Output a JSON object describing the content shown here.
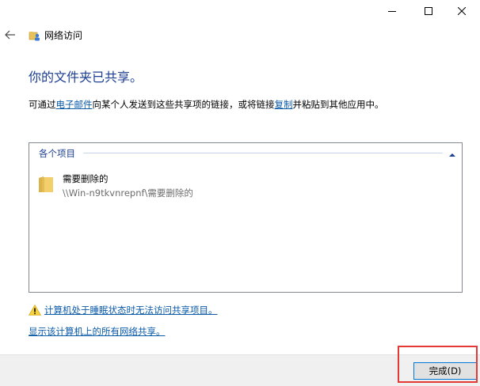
{
  "window": {
    "controls": [
      "minimize-icon",
      "maximize-icon",
      "close-icon"
    ]
  },
  "nav": {
    "back_icon": "back-arrow-icon",
    "title": "网络访问"
  },
  "main": {
    "heading": "你的文件夹已共享。",
    "desc_before_email": "可通过",
    "email_link": "电子邮件",
    "desc_middle": "向某个人发送到这些共享项的链接，或将链接",
    "copy_link": "复制",
    "desc_after": "并粘贴到其他应用中。"
  },
  "list": {
    "group_title": "各个项目",
    "items": [
      {
        "name": "需要删除的",
        "path": "\\\\Win-n9tkvnrepnf\\需要删除的"
      }
    ]
  },
  "links": {
    "sleep_warning": "计算机处于睡眠状态时无法访问共享项目。",
    "show_all_shares": "显示该计算机上的所有网络共享。"
  },
  "footer": {
    "done_label": "完成(D)"
  },
  "colors": {
    "heading": "#1c3e93",
    "link": "#0a5aa8",
    "accent_border": "#0078d7",
    "highlight": "#e53935"
  }
}
